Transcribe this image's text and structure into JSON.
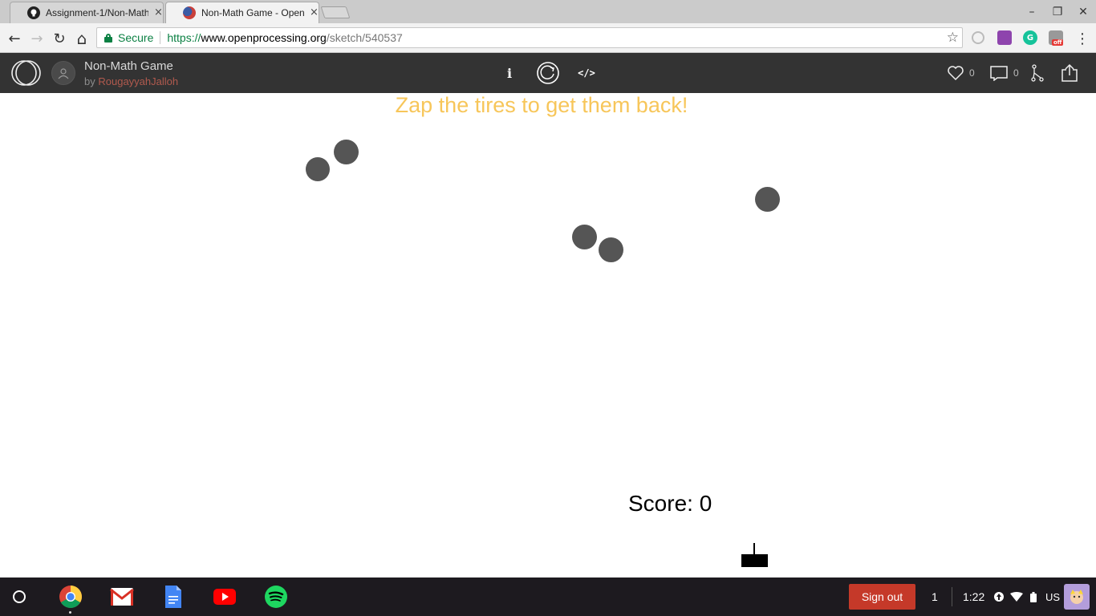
{
  "browser": {
    "tabs": [
      {
        "title": "Assignment-1/Non-Math",
        "close": "×",
        "active": false,
        "favicon": "github-icon"
      },
      {
        "title": "Non-Math Game - OpenP",
        "close": "×",
        "active": true,
        "favicon": "openprocessing-icon"
      }
    ],
    "window_controls": {
      "minimize": "–",
      "restore": "❐",
      "close": "✕"
    },
    "toolbar": {
      "back": "←",
      "forward": "→",
      "reload": "↻",
      "home": "⌂",
      "secure_label": "Secure",
      "url_scheme": "https://",
      "url_host": "www.openprocessing.org",
      "url_path": "/sketch/540537",
      "star": "☆",
      "menu": "⋮",
      "extensions": [
        {
          "name": "status-icon"
        },
        {
          "name": "puzzle-extension-icon"
        },
        {
          "name": "grammarly-icon",
          "label": "G"
        },
        {
          "name": "adblock-icon",
          "badge": "off"
        }
      ]
    }
  },
  "openprocessing": {
    "sketch_title": "Non-Math Game",
    "by_label": "by",
    "author": "RougayyahJalloh",
    "info_label": "i",
    "code_label": "</>",
    "likes": "0",
    "comments": "0"
  },
  "game": {
    "prompt": "Zap the tires to get them back!",
    "score_text": "Score: 0",
    "colors": {
      "prompt": "#f7c65a",
      "tire": "#555555"
    }
  },
  "shelf": {
    "apps": [
      "chrome-icon",
      "gmail-icon",
      "docs-icon",
      "youtube-icon",
      "spotify-icon"
    ],
    "signout_label": "Sign out",
    "notification_count": "1",
    "time": "1:22",
    "locale": "US"
  },
  "colors": {
    "header_bg": "#333333",
    "shelf_bg": "#1d1a1f",
    "signout_bg": "#c53929"
  }
}
